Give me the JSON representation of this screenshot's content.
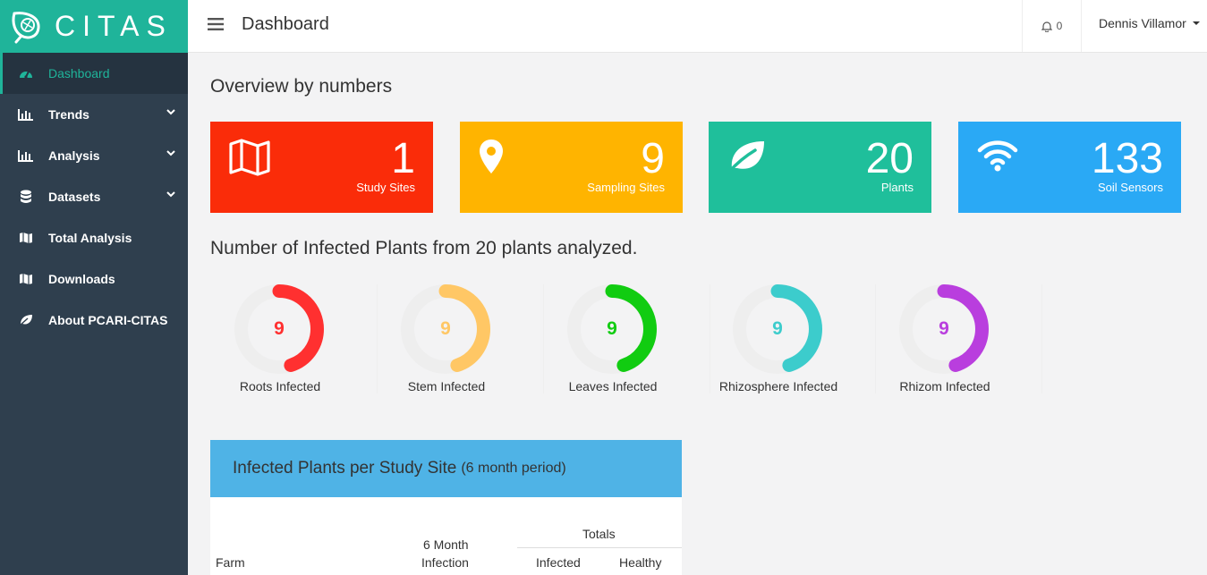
{
  "brand": {
    "name": "CITAS"
  },
  "sidebar": {
    "items": [
      {
        "label": "Dashboard",
        "icon": "dashboard-icon"
      },
      {
        "label": "Trends",
        "icon": "bar-chart-icon"
      },
      {
        "label": "Analysis",
        "icon": "bar-chart-icon"
      },
      {
        "label": "Datasets",
        "icon": "database-icon"
      },
      {
        "label": "Total Analysis",
        "icon": "map-icon"
      },
      {
        "label": "Downloads",
        "icon": "map-icon"
      },
      {
        "label": "About PCARI-CITAS",
        "icon": "leaf-icon"
      }
    ]
  },
  "header": {
    "title": "Dashboard",
    "notifications_count": "0",
    "user_name": "Dennis Villamor"
  },
  "overview": {
    "heading": "Overview by numbers",
    "cards": [
      {
        "value": "1",
        "label": "Study Sites",
        "icon": "map-icon",
        "color": "#fa2c09"
      },
      {
        "value": "9",
        "label": "Sampling Sites",
        "icon": "map-marker-icon",
        "color": "#ffb400"
      },
      {
        "value": "20",
        "label": "Plants",
        "icon": "leaf-icon",
        "color": "#1fbf9b"
      },
      {
        "value": "133",
        "label": "Soil Sensors",
        "icon": "wifi-icon",
        "color": "#2aa9f5"
      }
    ]
  },
  "infected": {
    "heading": "Number of Infected Plants from 20 plants analyzed.",
    "items": [
      {
        "value": "9",
        "label": "Roots Infected",
        "color": "#ff3030"
      },
      {
        "value": "9",
        "label": "Stem Infected",
        "color": "#ffc765"
      },
      {
        "value": "9",
        "label": "Leaves Infected",
        "color": "#11cc11"
      },
      {
        "value": "9",
        "label": "Rhizosphere Infected",
        "color": "#3ccccc"
      },
      {
        "value": "9",
        "label": "Rhizom Infected",
        "color": "#b93ede"
      }
    ],
    "total": 20,
    "track_color": "#eeeeee"
  },
  "table": {
    "title": "Infected Plants per Study Site",
    "title_suffix": "(6 month period)",
    "headers": {
      "farm": "Farm",
      "infection_line1": "6 Month",
      "infection_line2": "Infection",
      "totals": "Totals",
      "infected": "Infected",
      "healthy": "Healthy"
    }
  }
}
